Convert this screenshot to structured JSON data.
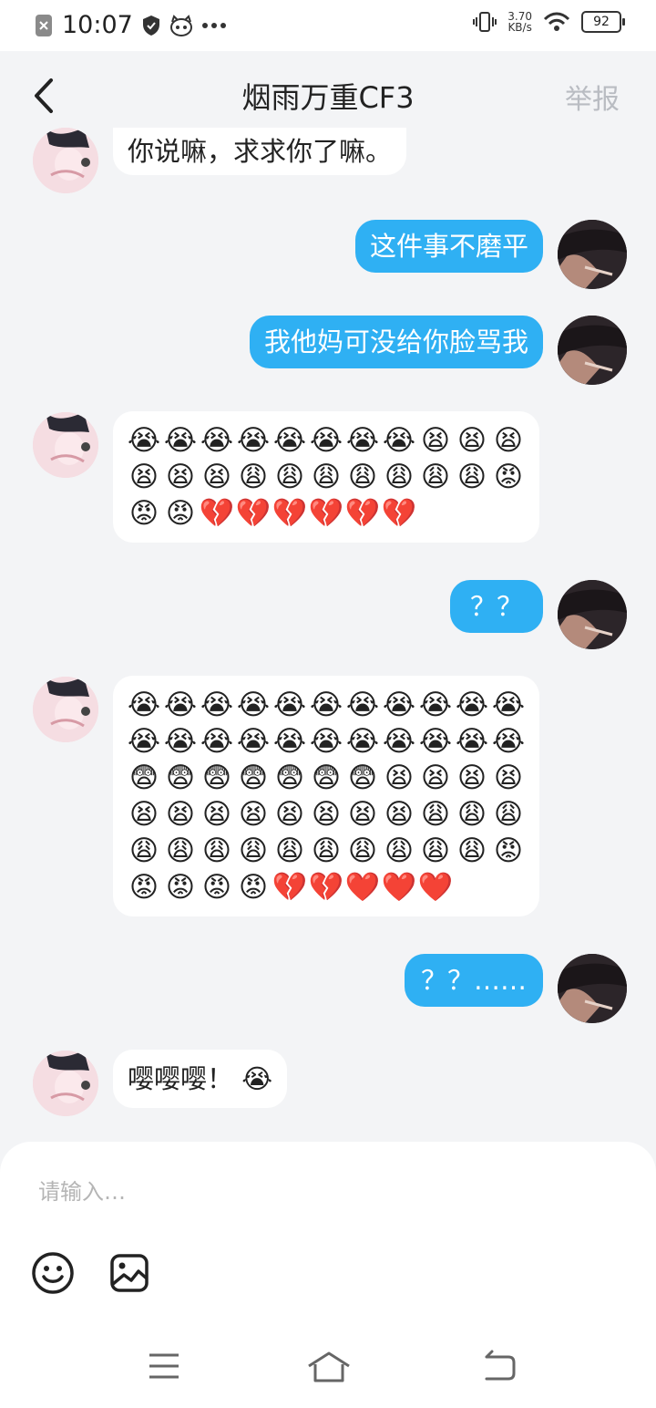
{
  "status_bar": {
    "time": "10:07",
    "speed_value": "3.70",
    "speed_unit": "KB/s",
    "battery": "92",
    "icons": [
      "notification-close-icon",
      "shield-icon",
      "mascot-icon",
      "more-dots-icon",
      "vibrate-icon",
      "wifi-icon",
      "battery-icon"
    ]
  },
  "header": {
    "title": "烟雨万重CF3",
    "report_label": "举报",
    "back_icon": "chevron-left-icon"
  },
  "messages": [
    {
      "side": "left",
      "type": "text",
      "text": "你说嘛，求求你了嘛。"
    },
    {
      "side": "right",
      "type": "text",
      "text": "这件事不磨平"
    },
    {
      "side": "right",
      "type": "text",
      "text": "我他妈可没给你脸骂我"
    },
    {
      "side": "left",
      "type": "emoji",
      "emojis": [
        "😭",
        "😭",
        "😭",
        "😭",
        "😭",
        "😭",
        "😭",
        "😭",
        "😫",
        "😫",
        "😫",
        "😫",
        "😫",
        "😫",
        "😩",
        "😩",
        "😩",
        "😩",
        "😩",
        "😩",
        "😩",
        "😡",
        "😡",
        "😡",
        "💔",
        "💔",
        "💔",
        "💔",
        "💔",
        "💔"
      ]
    },
    {
      "side": "right",
      "type": "text",
      "text": "？？"
    },
    {
      "side": "left",
      "type": "emoji",
      "emojis": [
        "😭",
        "😭",
        "😭",
        "😭",
        "😭",
        "😭",
        "😭",
        "😭",
        "😭",
        "😭",
        "😭",
        "😭",
        "😭",
        "😭",
        "😭",
        "😭",
        "😭",
        "😭",
        "😭",
        "😭",
        "😭",
        "😭",
        "😨",
        "😨",
        "😨",
        "😨",
        "😨",
        "😨",
        "😨",
        "😫",
        "😫",
        "😫",
        "😫",
        "😫",
        "😫",
        "😫",
        "😫",
        "😫",
        "😫",
        "😫",
        "😫",
        "😩",
        "😩",
        "😩",
        "😩",
        "😩",
        "😩",
        "😩",
        "😩",
        "😩",
        "😩",
        "😩",
        "😩",
        "😩",
        "😡",
        "😡",
        "😡",
        "😡",
        "😡",
        "💔",
        "💔",
        "❤️",
        "❤️",
        "❤️"
      ]
    },
    {
      "side": "right",
      "type": "text",
      "text": "？？……"
    },
    {
      "side": "left",
      "type": "text",
      "text": "嘤嘤嘤！ 😭"
    }
  ],
  "input": {
    "placeholder": "请输入…",
    "value": ""
  },
  "toolbar": {
    "icons": [
      "smiley-icon",
      "image-icon"
    ]
  },
  "navbar": {
    "icons": [
      "menu-icon",
      "home-icon",
      "back-icon"
    ]
  },
  "colors": {
    "accent": "#2fb0f3",
    "background": "#f3f4f6",
    "report_text": "#b9bcc2"
  }
}
